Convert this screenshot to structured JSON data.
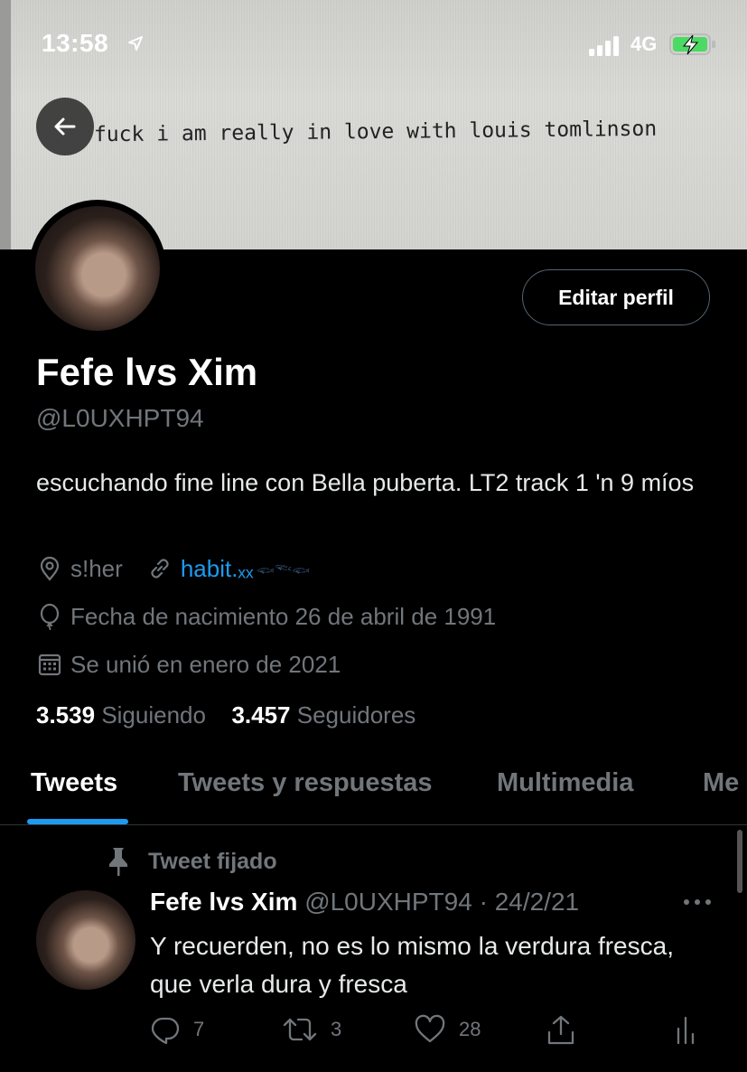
{
  "status_bar": {
    "time": "13:58",
    "network": "4G"
  },
  "banner": {
    "text": "fuck i am really in love with louis tomlinson"
  },
  "profile": {
    "edit_label": "Editar perfil",
    "name": "Fefe lvs Xim",
    "handle": "@L0UXHPT94",
    "bio": "escuchando fine line con Bella puberta. LT2 track 1 'n 9 míos",
    "location": "s!her",
    "link": "habit.ₓₓ",
    "link_decor": "𓆟𓆝𓆟",
    "birthday": "Fecha de nacimiento 26 de abril de 1991",
    "joined": "Se unió en enero de 2021",
    "following_count": "3.539",
    "following_label": "Siguiendo",
    "followers_count": "3.457",
    "followers_label": "Seguidores"
  },
  "tabs": [
    {
      "label": "Tweets",
      "active": true
    },
    {
      "label": "Tweets y respuestas"
    },
    {
      "label": "Multimedia"
    },
    {
      "label": "Me"
    }
  ],
  "tweet": {
    "pinned_label": "Tweet fijado",
    "name": "Fefe lvs Xim",
    "handle": "@L0UXHPT94",
    "separator": " · ",
    "date": "24/2/21",
    "text": "Y recuerden, no es lo mismo la verdura fresca, que verla dura y fresca",
    "replies": "7",
    "retweets": "3",
    "likes": "28"
  },
  "colors": {
    "accent": "#1d9bf0",
    "muted": "#71767b",
    "background": "#000000"
  },
  "icons": [
    "location-arrow-icon",
    "signal-icon",
    "battery-charging-icon",
    "back-arrow-icon",
    "location-icon",
    "link-icon",
    "balloon-icon",
    "calendar-icon",
    "pin-icon",
    "more-icon",
    "reply-icon",
    "retweet-icon",
    "like-icon",
    "share-icon",
    "analytics-icon"
  ]
}
